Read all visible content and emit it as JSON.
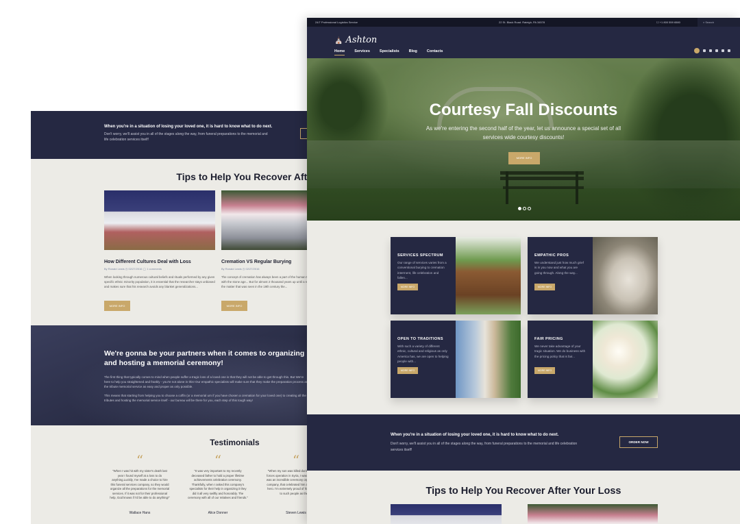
{
  "back": {
    "cta": {
      "heading": "When you're in a situation of losing your loved one, it is hard to know what to do next.",
      "text": "Don't worry, we'll assist you in all of the stages along the way, from funeral preparations to the memorial and life celebration services itself!"
    },
    "tips": {
      "title": "Tips to Help You Recover After Your Loss",
      "cards": [
        {
          "title": "How Different Cultures Deal with Loss",
          "meta": "By Ronald Lewis   ◷ 02/27/2016   ◯ 1 comments",
          "excerpt": "When looking through numerous cultural beliefs and rituals performed by any given specific ethnic minority population, it is essential that the researcher stays unbiased and makes sure that his research avoids any blanket generalizations...",
          "button": "MORE INFO"
        },
        {
          "title": "Cremation VS Regular Burying",
          "meta": "By Ronald Lewis   ◷ 02/27/2016",
          "excerpt": "The concept of cremation has always been a part of the human tradition, starting with the stone age... But for almost 2 thousand years up until a rekindled interest in the matter that was seen in the 19th century the...",
          "button": "MORE INFO"
        }
      ]
    },
    "partners": {
      "heading": "We're gonna be your partners when it comes to organizing and hosting a memorial ceremony!",
      "text1": "The first thing that typically comes to mind when people suffer a tragic loss of a loved one is that they will not be able to get through this. But We're here to help you straightened and frankly - you're not alone in this! Our empathic specialists will make sure that they make the preparation process and the tribute memorial service as easy and proper as only possible.",
      "text2": "This means that starting from helping you to choose a coffin (or a memorial urn if you have chosen a cremation for your loved one) to creating all the tributes and hosting the memorial service itself - our bureau will be there for you, each step of this tough way!"
    },
    "testimonials": {
      "title": "Testimonials",
      "items": [
        {
          "quote": "\"When I was hit with my sister's death last year I found myself at a loss to do anything.Luckily, I've made a choice to hire this funeral services company, so they would organize all the preparations for the memorial services. If it was not for their professional help, God knows if I'd be able to do anything!\"",
          "name": "Wallace Hans"
        },
        {
          "quote": "\"It was very important to my recently deceased father to hold a proper lifetime achievements celebration ceremony. Thankfully, when I asked this company's specialists for their help in organizing it they did it all very swiftly and honorably. The ceremony with all of our relatives and friends.\"",
          "name": "Alice Donner"
        },
        {
          "quote": "\"When my son was killed during the special forces operation in Syria, I was devastated. It was an incredible ceremony organized by the company, that celebrated him as a real fallen hero. I'm extremely proud of him and thanks to such people as them!\"",
          "name": "Steven Lewis"
        }
      ]
    }
  },
  "front": {
    "topbar": {
      "left": "24/7 Professional Logistics Service",
      "address": "22 St. Black Road. Raleigh, PA 34578",
      "phone": "☐ +1 800 559 6580",
      "search_placeholder": "Search"
    },
    "logo": "Ashton",
    "menu": [
      "Home",
      "Services",
      "Specialists",
      "Blog",
      "Contacts"
    ],
    "hero": {
      "title": "Courtesy Fall Discounts",
      "subtitle": "As we're entering the second half of the year, let us announce a special set of all services wide courtesy discounts!",
      "button": "MORE INFO",
      "active_slide": 1,
      "slides": 3
    },
    "services": [
      {
        "title": "SERVICES SPECTRUM",
        "text": "Our range of services varies from a conventional burying to cremation interment, life celebration and fallen...",
        "button": "MORE INFO"
      },
      {
        "title": "EMPATHIC PROS",
        "text": "We understand just how much grief is in you now and what you are going through. Along the way...",
        "button": "MORE INFO"
      },
      {
        "title": "OPEN TO TRADITIONS",
        "text": "With such a variety of different ethnic, cultural and religious as only America has, we are open to helping people with...",
        "button": "MORE INFO"
      },
      {
        "title": "FAIR PRICING",
        "text": "We never take advantage of your tragic situation. We do business with the pricing policy that is fair...",
        "button": "MORE INFO"
      }
    ],
    "cta": {
      "heading": "When you're in a situation of losing your loved one, it is hard to know what to do next.",
      "text": "Don't worry, we'll assist you in all of the stages along the way, from funeral preparations to the memorial and life celebration services itself!",
      "button": "ORDER NOW"
    },
    "tips_title": "Tips to Help You Recover After Your Loss"
  },
  "colors": {
    "navy": "#252842",
    "gold": "#c9a86a",
    "beige": "#ecebe6"
  }
}
